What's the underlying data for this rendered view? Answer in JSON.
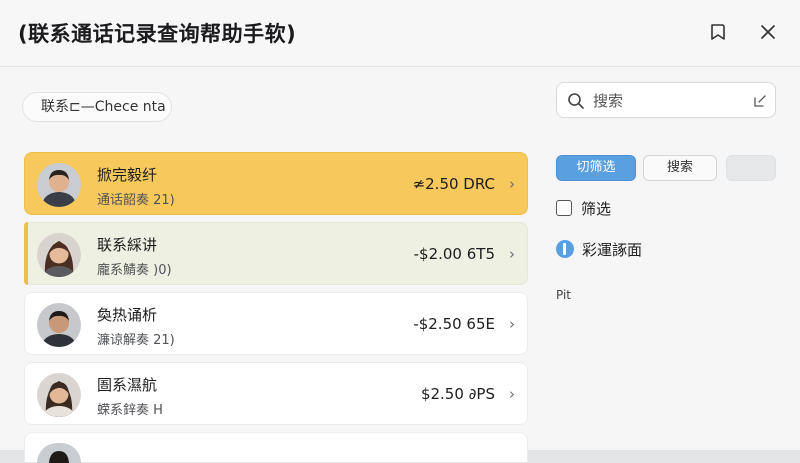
{
  "window": {
    "title": "(联系通话记录查询帮助手软)"
  },
  "context_pill": "联系⊏—Chece nta",
  "contacts": [
    {
      "name": "掀完毅纤",
      "subtitle": "通话韶奏 21)",
      "amount": "≄2.50 DRC",
      "state": "active"
    },
    {
      "name": "联系綵讲",
      "subtitle": "龐系鯖奏 )0)",
      "amount": "-$2.00 6T5",
      "state": "hover"
    },
    {
      "name": "奐热诵析",
      "subtitle": "濂谅解奏 21)",
      "amount": "-$2.50 65E",
      "state": "normal"
    },
    {
      "name": "圄系濕航",
      "subtitle": "蝾系鋅奏 H",
      "amount": "$2.50 ∂PS",
      "state": "normal"
    },
    {
      "name": "",
      "subtitle": "",
      "amount": "",
      "state": "normal"
    }
  ],
  "chevron": "›",
  "search": {
    "placeholder": "搜索"
  },
  "segments": [
    "切筛选",
    "搜索",
    ""
  ],
  "filter_checkbox_label": "筛选",
  "toggle_label": "彩運諑面",
  "small_label": "Pit",
  "colors": {
    "accent_blue": "#5a9fe0",
    "active_row": "#f7c95c",
    "hover_row": "#eef0e1"
  }
}
